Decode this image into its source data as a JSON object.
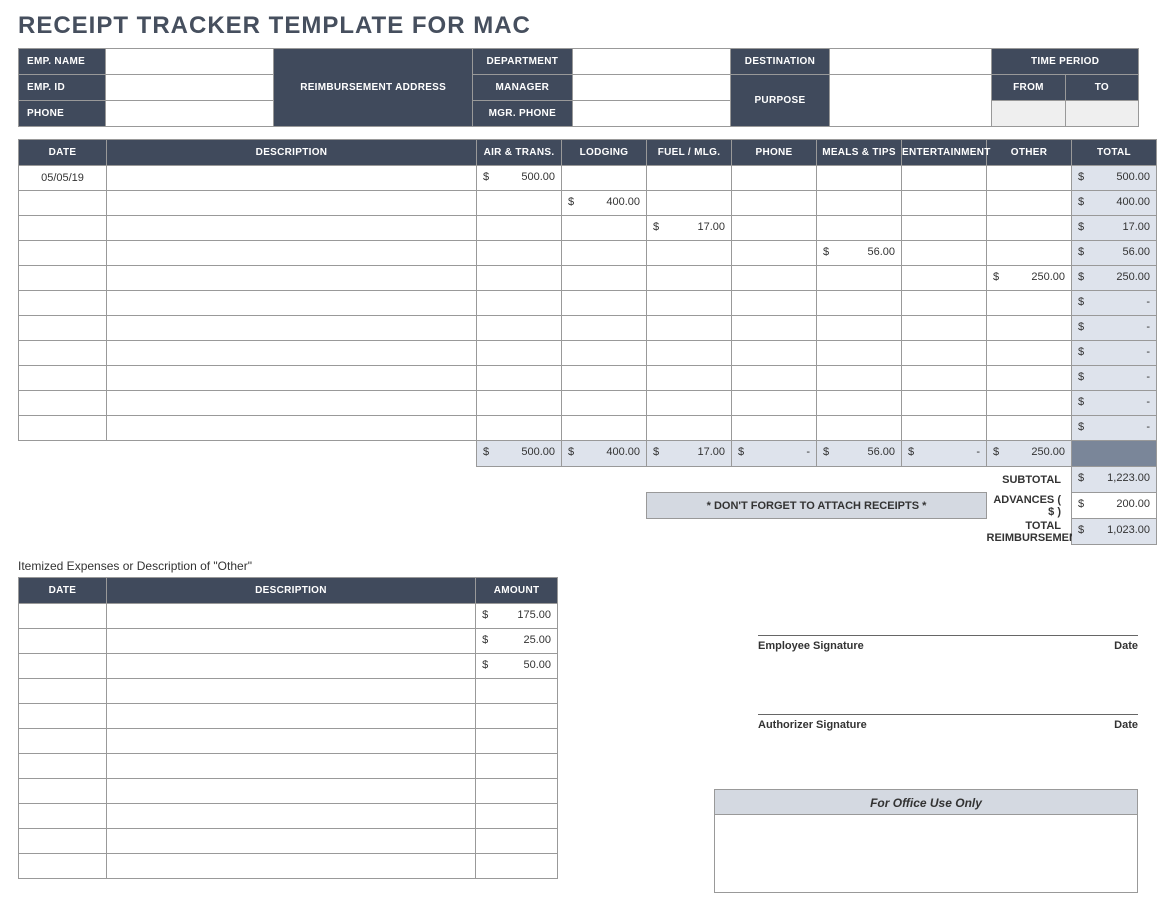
{
  "title": "RECEIPT TRACKER TEMPLATE FOR MAC",
  "info": {
    "labels": {
      "emp_name": "EMP. NAME",
      "emp_id": "EMP. ID",
      "phone": "PHONE",
      "reimb_addr": "REIMBURSEMENT ADDRESS",
      "department": "DEPARTMENT",
      "manager": "MANAGER",
      "mgr_phone": "MGR. PHONE",
      "destination": "DESTINATION",
      "purpose": "PURPOSE",
      "time_period": "TIME PERIOD",
      "from": "FROM",
      "to": "TO"
    }
  },
  "expense_headers": [
    "DATE",
    "DESCRIPTION",
    "AIR & TRANS.",
    "LODGING",
    "FUEL / MLG.",
    "PHONE",
    "MEALS & TIPS",
    "ENTERTAINMENT",
    "OTHER",
    "TOTAL"
  ],
  "expenses": [
    {
      "date": "05/05/19",
      "desc": "",
      "air": "500.00",
      "lodging": "",
      "fuel": "",
      "phone": "",
      "meals": "",
      "ent": "",
      "other": "",
      "total": "500.00"
    },
    {
      "date": "",
      "desc": "",
      "air": "",
      "lodging": "400.00",
      "fuel": "",
      "phone": "",
      "meals": "",
      "ent": "",
      "other": "",
      "total": "400.00"
    },
    {
      "date": "",
      "desc": "",
      "air": "",
      "lodging": "",
      "fuel": "17.00",
      "phone": "",
      "meals": "",
      "ent": "",
      "other": "",
      "total": "17.00"
    },
    {
      "date": "",
      "desc": "",
      "air": "",
      "lodging": "",
      "fuel": "",
      "phone": "",
      "meals": "56.00",
      "ent": "",
      "other": "",
      "total": "56.00"
    },
    {
      "date": "",
      "desc": "",
      "air": "",
      "lodging": "",
      "fuel": "",
      "phone": "",
      "meals": "",
      "ent": "",
      "other": "250.00",
      "total": "250.00"
    },
    {
      "date": "",
      "desc": "",
      "air": "",
      "lodging": "",
      "fuel": "",
      "phone": "",
      "meals": "",
      "ent": "",
      "other": "",
      "total": "-"
    },
    {
      "date": "",
      "desc": "",
      "air": "",
      "lodging": "",
      "fuel": "",
      "phone": "",
      "meals": "",
      "ent": "",
      "other": "",
      "total": "-"
    },
    {
      "date": "",
      "desc": "",
      "air": "",
      "lodging": "",
      "fuel": "",
      "phone": "",
      "meals": "",
      "ent": "",
      "other": "",
      "total": "-"
    },
    {
      "date": "",
      "desc": "",
      "air": "",
      "lodging": "",
      "fuel": "",
      "phone": "",
      "meals": "",
      "ent": "",
      "other": "",
      "total": "-"
    },
    {
      "date": "",
      "desc": "",
      "air": "",
      "lodging": "",
      "fuel": "",
      "phone": "",
      "meals": "",
      "ent": "",
      "other": "",
      "total": "-"
    },
    {
      "date": "",
      "desc": "",
      "air": "",
      "lodging": "",
      "fuel": "",
      "phone": "",
      "meals": "",
      "ent": "",
      "other": "",
      "total": "-"
    }
  ],
  "column_totals": {
    "air": "500.00",
    "lodging": "400.00",
    "fuel": "17.00",
    "phone": "-",
    "meals": "56.00",
    "ent": "-",
    "other": "250.00"
  },
  "summary": {
    "subtotal_label": "SUBTOTAL",
    "subtotal": "1,223.00",
    "advances_label": "ADVANCES  ( $ )",
    "advances": "200.00",
    "total_label": "TOTAL REIMBURSEMENT",
    "total": "1,023.00",
    "banner": "* DON'T FORGET TO ATTACH RECEIPTS *"
  },
  "itemized": {
    "title": "Itemized Expenses or Description of \"Other\"",
    "headers": [
      "DATE",
      "DESCRIPTION",
      "AMOUNT"
    ],
    "rows": [
      {
        "date": "",
        "desc": "",
        "amount": "175.00"
      },
      {
        "date": "",
        "desc": "",
        "amount": "25.00"
      },
      {
        "date": "",
        "desc": "",
        "amount": "50.00"
      },
      {
        "date": "",
        "desc": "",
        "amount": ""
      },
      {
        "date": "",
        "desc": "",
        "amount": ""
      },
      {
        "date": "",
        "desc": "",
        "amount": ""
      },
      {
        "date": "",
        "desc": "",
        "amount": ""
      },
      {
        "date": "",
        "desc": "",
        "amount": ""
      },
      {
        "date": "",
        "desc": "",
        "amount": ""
      },
      {
        "date": "",
        "desc": "",
        "amount": ""
      },
      {
        "date": "",
        "desc": "",
        "amount": ""
      }
    ]
  },
  "signatures": {
    "employee": "Employee Signature",
    "authorizer": "Authorizer Signature",
    "date": "Date"
  },
  "office": "For Office Use Only"
}
